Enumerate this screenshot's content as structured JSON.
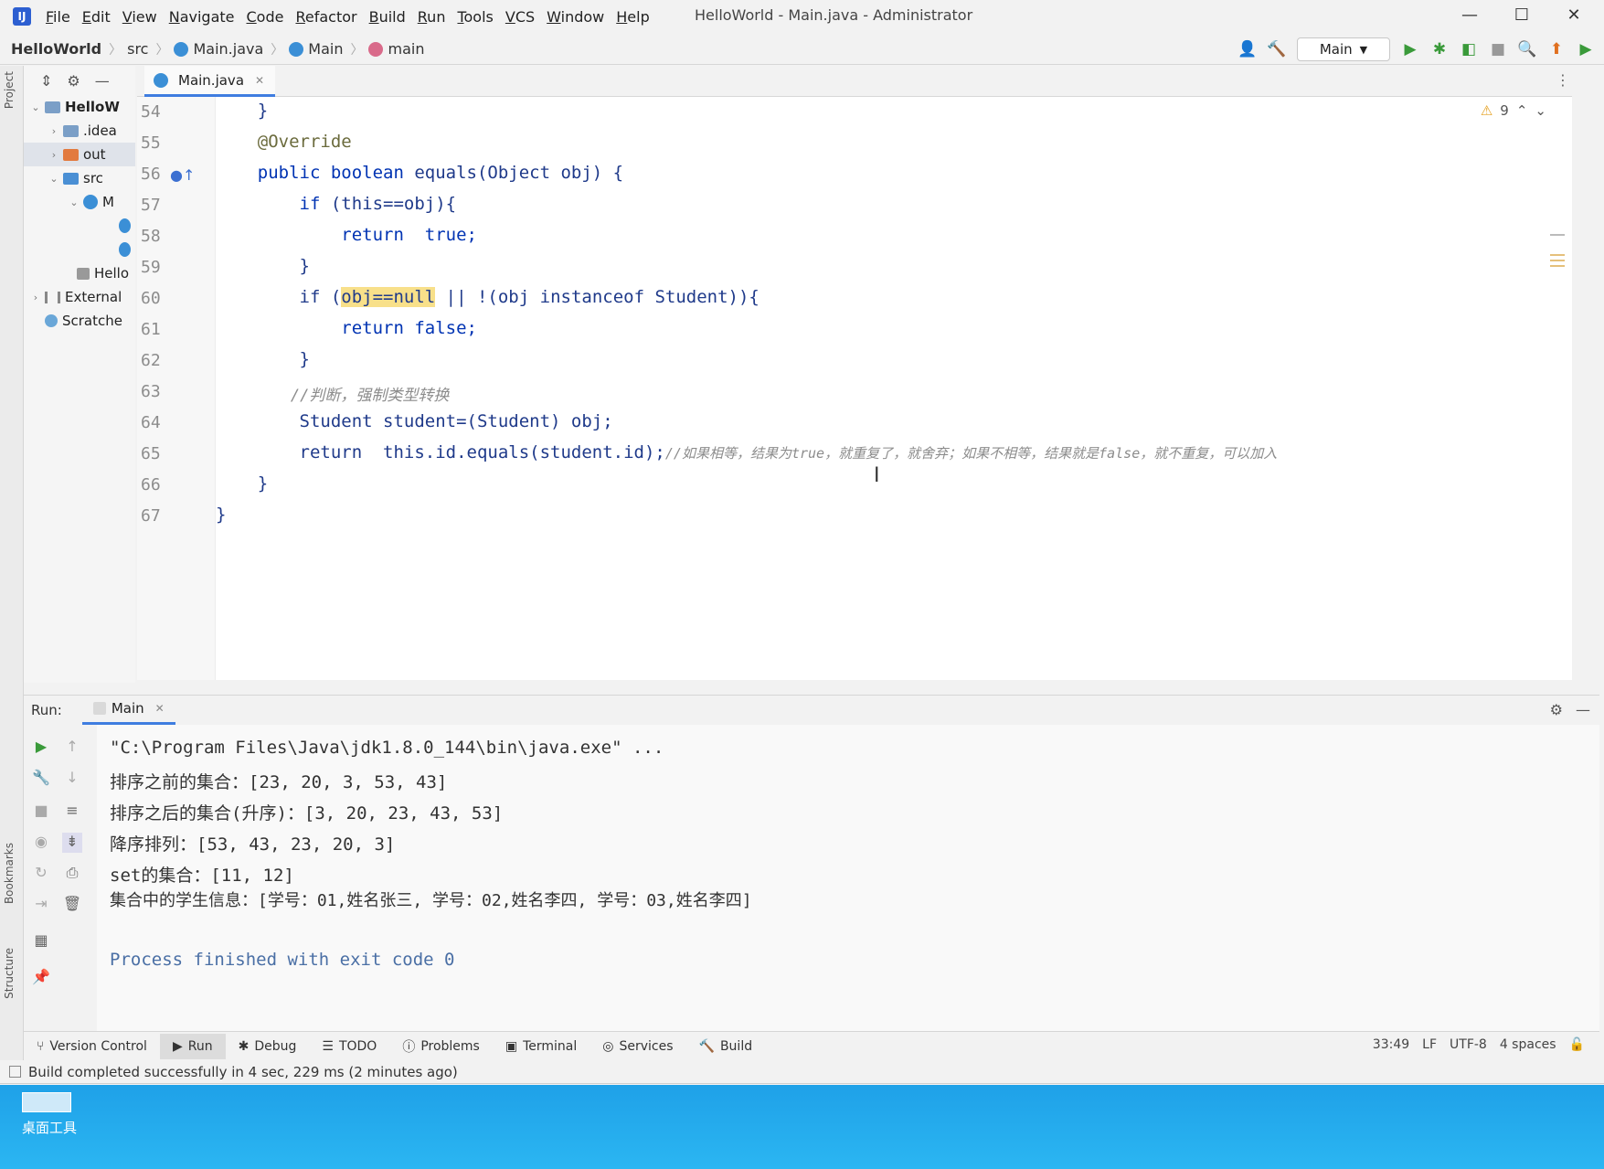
{
  "menubar": {
    "logo": "IJ",
    "items": [
      "File",
      "Edit",
      "View",
      "Navigate",
      "Code",
      "Refactor",
      "Build",
      "Run",
      "Tools",
      "VCS",
      "Window",
      "Help"
    ],
    "window_title": "HelloWorld - Main.java - Administrator",
    "controls": [
      "—",
      "☐",
      "✕"
    ]
  },
  "navbar": {
    "breadcrumbs": [
      "HelloWorld",
      "src",
      "Main.java",
      "Main",
      "main"
    ],
    "run_config": "Main"
  },
  "left_stripe": {
    "project": "Project",
    "bookmarks": "Bookmarks",
    "structure": "Structure"
  },
  "project_tree": {
    "rows": [
      {
        "label": "HelloW",
        "indent": 0,
        "arrow": "⌄"
      },
      {
        "label": ".idea",
        "indent": 1,
        "arrow": "›"
      },
      {
        "label": "out",
        "indent": 1,
        "arrow": "›"
      },
      {
        "label": "src",
        "indent": 1,
        "arrow": "⌄"
      },
      {
        "label": "M",
        "indent": 2,
        "arrow": "⌄"
      },
      {
        "label": "",
        "indent": 3,
        "arrow": ""
      },
      {
        "label": "",
        "indent": 3,
        "arrow": ""
      },
      {
        "label": "Hello",
        "indent": 1,
        "arrow": ""
      },
      {
        "label": "External",
        "indent": 0,
        "arrow": "›"
      },
      {
        "label": "Scratche",
        "indent": 0,
        "arrow": ""
      }
    ]
  },
  "editor": {
    "tab": "Main.java",
    "warnings": "9",
    "line_numbers": [
      "54",
      "55",
      "56",
      "57",
      "58",
      "59",
      "60",
      "61",
      "62",
      "63",
      "64",
      "65",
      "66",
      "67"
    ],
    "code": {
      "l54": "    }",
      "l55": "    @Override",
      "l56_kw": "    public boolean",
      "l56_rest": " equals(Object obj) {",
      "l57_kw": "        if",
      "l57_rest": " (this==obj){",
      "l58": "            return  true;",
      "l59": "        }",
      "l60_a": "        if (",
      "l60_hl": "obj==null",
      "l60_b": " || !(obj instanceof Student)){",
      "l61": "            return false;",
      "l62": "        }",
      "l63": "        //判断，强制类型转换",
      "l64": "        Student student=(Student) obj;",
      "l65_code": "        return  this.id.equals(student.id);",
      "l65_comment": "//如果相等，结果为true，就重复了，就舍弃；如果不相等，结果就是false，就不重复，可以加入",
      "l66": "    }",
      "l67": "}"
    }
  },
  "run_panel": {
    "label": "Run:",
    "tab": "Main",
    "output": [
      "\"C:\\Program Files\\Java\\jdk1.8.0_144\\bin\\java.exe\" ...",
      "排序之前的集合：[23, 20, 3, 53, 43]",
      "排序之后的集合(升序)：[3, 20, 23, 43, 53]",
      "降序排列：[53, 43, 23, 20, 3]",
      "set的集合：[11, 12]",
      "集合中的学生信息：[学号：01,姓名张三, 学号：02,姓名李四, 学号：03,姓名李四]",
      "",
      "Process finished with exit code 0"
    ]
  },
  "bottom_tabs": [
    "Version Control",
    "Run",
    "Debug",
    "TODO",
    "Problems",
    "Terminal",
    "Services",
    "Build"
  ],
  "status": {
    "position": "33:49",
    "line_sep": "LF",
    "encoding": "UTF-8",
    "indent": "4 spaces",
    "message": "Build completed successfully in 4 sec, 229 ms (2 minutes ago)"
  },
  "desktop": {
    "label": "桌面工具"
  }
}
